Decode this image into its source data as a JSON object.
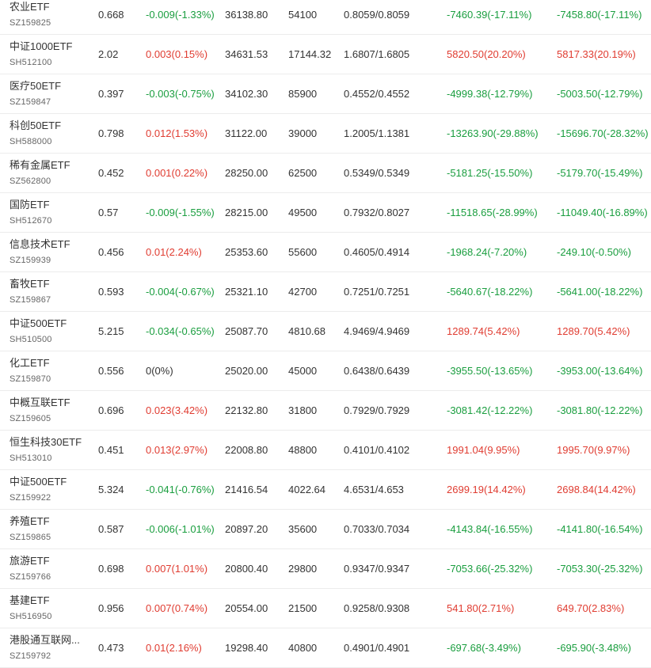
{
  "colors": {
    "up": "#e03c31",
    "down": "#1a9e3f",
    "flat": "#333333"
  },
  "rows": [
    {
      "name": "农业ETF",
      "code": "SZ159825",
      "price": "0.668",
      "change": "-0.009(-1.33%)",
      "volume": "36138.80",
      "shares": "54100",
      "nav": "0.8059/0.8059",
      "premium1": "-7460.39(-17.11%)",
      "premium2": "-7458.80(-17.11%)"
    },
    {
      "name": "中证1000ETF",
      "code": "SH512100",
      "price": "2.02",
      "change": "0.003(0.15%)",
      "volume": "34631.53",
      "shares": "17144.32",
      "nav": "1.6807/1.6805",
      "premium1": "5820.50(20.20%)",
      "premium2": "5817.33(20.19%)"
    },
    {
      "name": "医疗50ETF",
      "code": "SZ159847",
      "price": "0.397",
      "change": "-0.003(-0.75%)",
      "volume": "34102.30",
      "shares": "85900",
      "nav": "0.4552/0.4552",
      "premium1": "-4999.38(-12.79%)",
      "premium2": "-5003.50(-12.79%)"
    },
    {
      "name": "科创50ETF",
      "code": "SH588000",
      "price": "0.798",
      "change": "0.012(1.53%)",
      "volume": "31122.00",
      "shares": "39000",
      "nav": "1.2005/1.1381",
      "premium1": "-13263.90(-29.88%)",
      "premium2": "-15696.70(-28.32%)"
    },
    {
      "name": "稀有金属ETF",
      "code": "SZ562800",
      "price": "0.452",
      "change": "0.001(0.22%)",
      "volume": "28250.00",
      "shares": "62500",
      "nav": "0.5349/0.5349",
      "premium1": "-5181.25(-15.50%)",
      "premium2": "-5179.70(-15.49%)"
    },
    {
      "name": "国防ETF",
      "code": "SH512670",
      "price": "0.57",
      "change": "-0.009(-1.55%)",
      "volume": "28215.00",
      "shares": "49500",
      "nav": "0.7932/0.8027",
      "premium1": "-11518.65(-28.99%)",
      "premium2": "-11049.40(-16.89%)"
    },
    {
      "name": "信息技术ETF",
      "code": "SZ159939",
      "price": "0.456",
      "change": "0.01(2.24%)",
      "volume": "25353.60",
      "shares": "55600",
      "nav": "0.4605/0.4914",
      "premium1": "-1968.24(-7.20%)",
      "premium2": "-249.10(-0.50%)"
    },
    {
      "name": "畜牧ETF",
      "code": "SZ159867",
      "price": "0.593",
      "change": "-0.004(-0.67%)",
      "volume": "25321.10",
      "shares": "42700",
      "nav": "0.7251/0.7251",
      "premium1": "-5640.67(-18.22%)",
      "premium2": "-5641.00(-18.22%)"
    },
    {
      "name": "中证500ETF",
      "code": "SH510500",
      "price": "5.215",
      "change": "-0.034(-0.65%)",
      "volume": "25087.70",
      "shares": "4810.68",
      "nav": "4.9469/4.9469",
      "premium1": "1289.74(5.42%)",
      "premium2": "1289.70(5.42%)"
    },
    {
      "name": "化工ETF",
      "code": "SZ159870",
      "price": "0.556",
      "change": "0(0%)",
      "volume": "25020.00",
      "shares": "45000",
      "nav": "0.6438/0.6439",
      "premium1": "-3955.50(-13.65%)",
      "premium2": "-3953.00(-13.64%)"
    },
    {
      "name": "中概互联ETF",
      "code": "SZ159605",
      "price": "0.696",
      "change": "0.023(3.42%)",
      "volume": "22132.80",
      "shares": "31800",
      "nav": "0.7929/0.7929",
      "premium1": "-3081.42(-12.22%)",
      "premium2": "-3081.80(-12.22%)"
    },
    {
      "name": "恒生科技30ETF",
      "code": "SH513010",
      "price": "0.451",
      "change": "0.013(2.97%)",
      "volume": "22008.80",
      "shares": "48800",
      "nav": "0.4101/0.4102",
      "premium1": "1991.04(9.95%)",
      "premium2": "1995.70(9.97%)"
    },
    {
      "name": "中证500ETF",
      "code": "SZ159922",
      "price": "5.324",
      "change": "-0.041(-0.76%)",
      "volume": "21416.54",
      "shares": "4022.64",
      "nav": "4.6531/4.653",
      "premium1": "2699.19(14.42%)",
      "premium2": "2698.84(14.42%)"
    },
    {
      "name": "养殖ETF",
      "code": "SZ159865",
      "price": "0.587",
      "change": "-0.006(-1.01%)",
      "volume": "20897.20",
      "shares": "35600",
      "nav": "0.7033/0.7034",
      "premium1": "-4143.84(-16.55%)",
      "premium2": "-4141.80(-16.54%)"
    },
    {
      "name": "旅游ETF",
      "code": "SZ159766",
      "price": "0.698",
      "change": "0.007(1.01%)",
      "volume": "20800.40",
      "shares": "29800",
      "nav": "0.9347/0.9347",
      "premium1": "-7053.66(-25.32%)",
      "premium2": "-7053.30(-25.32%)"
    },
    {
      "name": "基建ETF",
      "code": "SH516950",
      "price": "0.956",
      "change": "0.007(0.74%)",
      "volume": "20554.00",
      "shares": "21500",
      "nav": "0.9258/0.9308",
      "premium1": "541.80(2.71%)",
      "premium2": "649.70(2.83%)"
    },
    {
      "name": "港股通互联网...",
      "code": "SZ159792",
      "price": "0.473",
      "change": "0.01(2.16%)",
      "volume": "19298.40",
      "shares": "40800",
      "nav": "0.4901/0.4901",
      "premium1": "-697.68(-3.49%)",
      "premium2": "-695.90(-3.48%)"
    }
  ]
}
